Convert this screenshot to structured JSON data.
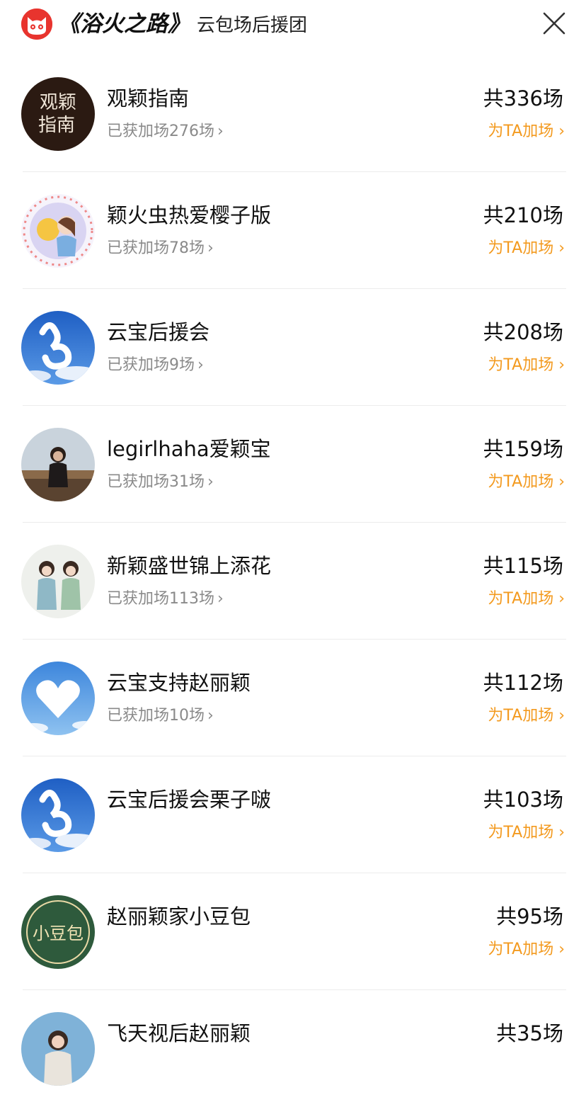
{
  "header": {
    "title": "《浴火之路》",
    "subtitle": "云包场后援团",
    "close_icon": "close-icon",
    "logo_icon": "cat-logo-icon",
    "brand_color": "#e8342e"
  },
  "accent_color": "#f39a1f",
  "rows": [
    {
      "name": "观颖指南",
      "sub": "已获加场276场",
      "total": "共336场",
      "boost": "为TA加场"
    },
    {
      "name": "颖火虫热爱樱子版",
      "sub": "已获加场78场",
      "total": "共210场",
      "boost": "为TA加场"
    },
    {
      "name": "云宝后援会",
      "sub": "已获加场9场",
      "total": "共208场",
      "boost": "为TA加场"
    },
    {
      "name": "legirlhaha爱颖宝",
      "sub": "已获加场31场",
      "total": "共159场",
      "boost": "为TA加场"
    },
    {
      "name": "新颖盛世锦上添花",
      "sub": "已获加场113场",
      "total": "共115场",
      "boost": "为TA加场"
    },
    {
      "name": "云宝支持赵丽颖",
      "sub": "已获加场10场",
      "total": "共112场",
      "boost": "为TA加场"
    },
    {
      "name": "云宝后援会栗子啵",
      "sub": "",
      "total": "共103场",
      "boost": "为TA加场"
    },
    {
      "name": "赵丽颖家小豆包",
      "sub": "",
      "total": "共95场",
      "boost": "为TA加场"
    },
    {
      "name": "飞天视后赵丽颖",
      "sub": "",
      "total": "共35场",
      "boost": ""
    }
  ],
  "avatar_texts": {
    "guide_line1": "观颖",
    "guide_line2": "指南",
    "bean": "小豆包"
  }
}
